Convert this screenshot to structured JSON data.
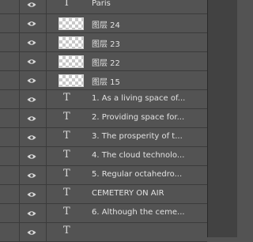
{
  "layers": [
    {
      "name": "Paris",
      "kind": "text",
      "type_glyph": "T",
      "visible": true
    },
    {
      "name": "图层 24",
      "kind": "image",
      "visible": true
    },
    {
      "name": "图层 23",
      "kind": "image",
      "visible": true
    },
    {
      "name": "图层 22",
      "kind": "image",
      "visible": true
    },
    {
      "name": "图层 15",
      "kind": "image",
      "visible": true
    },
    {
      "name": "1. As a living space of...",
      "kind": "text",
      "type_glyph": "T",
      "visible": true
    },
    {
      "name": "2. Providing space for...",
      "kind": "text",
      "type_glyph": "T",
      "visible": true
    },
    {
      "name": "3. The prosperity of t...",
      "kind": "text",
      "type_glyph": "T",
      "visible": true
    },
    {
      "name": "4. The cloud technolo...",
      "kind": "text",
      "type_glyph": "T",
      "visible": true
    },
    {
      "name": "5. Regular octahedro...",
      "kind": "text",
      "type_glyph": "T",
      "visible": true
    },
    {
      "name": "CEMETERY ON AIR",
      "kind": "text",
      "type_glyph": "T",
      "visible": true
    },
    {
      "name": "6. Although the ceme...",
      "kind": "text",
      "type_glyph": "T",
      "visible": true
    },
    {
      "name": "",
      "kind": "text",
      "type_glyph": "T",
      "visible": true
    }
  ],
  "icons": {
    "visibility": "eye-icon",
    "text_layer": "text-layer-icon",
    "thumbnail": "layer-thumbnail"
  },
  "colors": {
    "panel": "#535353",
    "text": "#e2e2e2",
    "separator": "#3b3b3b"
  }
}
